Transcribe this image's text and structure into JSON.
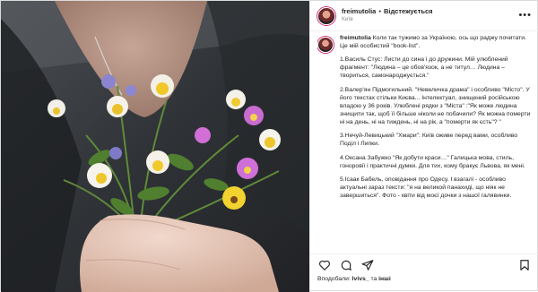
{
  "post": {
    "username": "freimutolia",
    "follow_label": "Відстежується",
    "location": "Київ",
    "more_icon": "more-horizontal-icon"
  },
  "caption": {
    "username": "freimutolia",
    "intro": "Коли так тужимо за Україною, ось що раджу почитати. Це мій особистий \"book-list\".",
    "items": [
      "1.Василь Стус: Листи до сина і до дружини. Мій улюблений фрагмент: \"Людина – це обов'язок, а не титул… Людина – твориться, самонароджується.\"",
      "2.Валер'ян Підмогильний. \"Невеличка драма\" і особливо \"Місто\". У його текстах стільки Києва... Інтелектуал, знищений російською владою у 36 років. Улюблені рядки з \"Міста\" :\"Як може людина знищити так, щоб її більше ніколи не побачили? Як можна померти ні на день, ні на тиждень, ні на рік, а \"померти як єсть\"? \"",
      "3.Нечуй-Левицький \"Хмари\": Київ оживе перед вами, особливо Поділ і Липки.",
      "4.Оксана Забужко \"Як добути краси…\" Галицька мова, стиль, гоноровії і практичні думки. Для тих, кому бракує Львова, як мені.",
      "5.Ісаак Бабель, оповідання про Одесу. І взагалі - особливо актуальні зараз тексти: \"я на великой панахиді, що ніяк не завершиться\". Фото - квіти від моєї дочки з нашої галявинки."
    ]
  },
  "actions": {
    "icons": [
      "heart-icon",
      "comment-icon",
      "share-icon",
      "bookmark-icon"
    ]
  },
  "likes": {
    "prefix": "Вподобали: ",
    "user": "lvivs_",
    "middle": " та ",
    "others": "інші"
  },
  "colors": {
    "accent": "#d62976",
    "muted": "#8e8e8e",
    "text": "#262626"
  }
}
